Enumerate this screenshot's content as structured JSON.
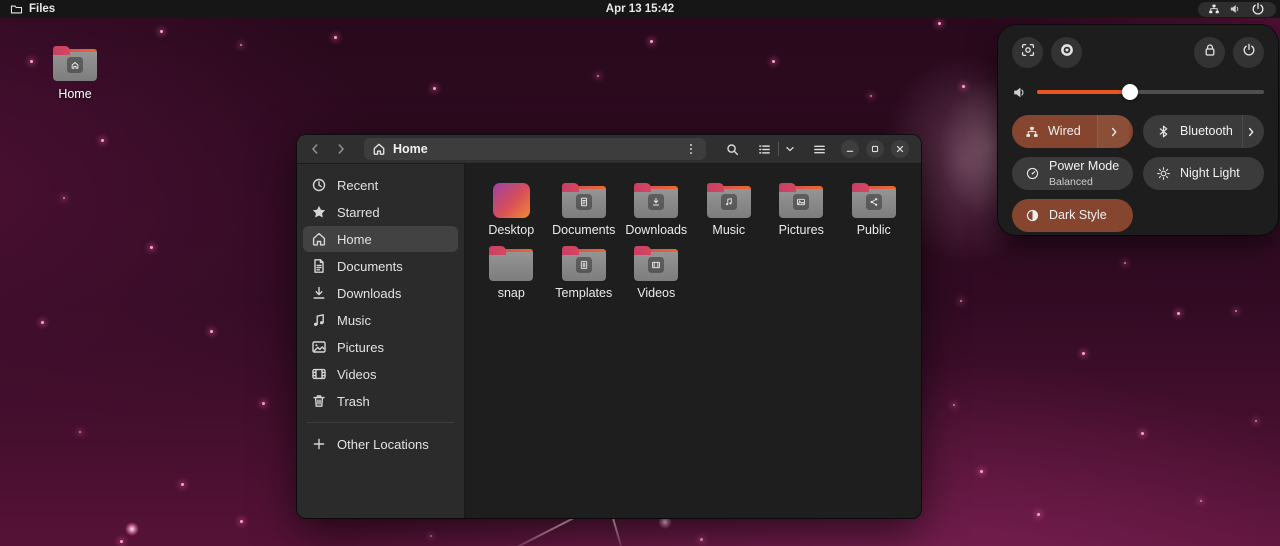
{
  "topbar": {
    "app_name": "Files",
    "clock": "Apr 13 15:42",
    "tray_icons": [
      "network-wired-icon",
      "volume-icon",
      "power-icon"
    ]
  },
  "desktop_icons": [
    {
      "label": "Home",
      "emblem": "house"
    }
  ],
  "window": {
    "title_location": "Home",
    "headerbar": {
      "back": "back-button",
      "forward": "forward-button",
      "pathbar_location": "Home",
      "icons": [
        "kebab-menu-icon",
        "search-icon",
        "list-view-icon",
        "chevron-down-icon",
        "hamburger-menu-icon"
      ],
      "window_controls": [
        "minimize",
        "maximize",
        "close"
      ]
    },
    "sidebar": {
      "items": [
        {
          "label": "Recent",
          "icon": "recent",
          "active": false
        },
        {
          "label": "Starred",
          "icon": "star",
          "active": false
        },
        {
          "label": "Home",
          "icon": "home",
          "active": true
        },
        {
          "label": "Documents",
          "icon": "document",
          "active": false
        },
        {
          "label": "Downloads",
          "icon": "download",
          "active": false
        },
        {
          "label": "Music",
          "icon": "music",
          "active": false
        },
        {
          "label": "Pictures",
          "icon": "picture",
          "active": false
        },
        {
          "label": "Videos",
          "icon": "video",
          "active": false
        },
        {
          "label": "Trash",
          "icon": "trash",
          "active": false
        }
      ],
      "other_locations": {
        "label": "Other Locations",
        "icon": "plus"
      }
    },
    "folders": [
      {
        "name": "Desktop",
        "style": "desktop",
        "emblem": null
      },
      {
        "name": "Documents",
        "style": "folder",
        "emblem": "document"
      },
      {
        "name": "Downloads",
        "style": "folder",
        "emblem": "download"
      },
      {
        "name": "Music",
        "style": "folder",
        "emblem": "music"
      },
      {
        "name": "Pictures",
        "style": "folder",
        "emblem": "picture"
      },
      {
        "name": "Public",
        "style": "folder",
        "emblem": "share"
      },
      {
        "name": "snap",
        "style": "folder",
        "emblem": null
      },
      {
        "name": "Templates",
        "style": "folder",
        "emblem": "template"
      },
      {
        "name": "Videos",
        "style": "folder",
        "emblem": "video"
      }
    ]
  },
  "quick_settings": {
    "top_buttons": [
      {
        "name": "screenshot-button",
        "icon": "screenshot"
      },
      {
        "name": "settings-button",
        "icon": "gear"
      },
      {
        "name": "lock-button",
        "icon": "lock",
        "right": true
      },
      {
        "name": "power-button",
        "icon": "power",
        "right": true
      }
    ],
    "volume": {
      "level": 41,
      "icon": "volume"
    },
    "toggles": [
      {
        "label": "Wired",
        "icon": "network-wired",
        "active": true,
        "chevron": true
      },
      {
        "label": "Bluetooth",
        "icon": "bluetooth",
        "active": false,
        "chevron": true
      },
      {
        "label": "Power Mode",
        "subtitle": "Balanced",
        "icon": "power-mode",
        "active": false,
        "chevron": false
      },
      {
        "label": "Night Light",
        "icon": "night-light",
        "active": false,
        "chevron": false
      },
      {
        "label": "Dark Style",
        "icon": "dark-style",
        "active": true,
        "chevron": false
      }
    ]
  },
  "colors": {
    "accent_orange": "#E95420",
    "active_toggle": "#85452e",
    "panel_bg": "#1d1d1d",
    "window_header": "#2f2f2f",
    "sidebar_bg": "#2b2b2b",
    "content_bg": "#1e1e1e",
    "topbar_bg": "#161616"
  }
}
